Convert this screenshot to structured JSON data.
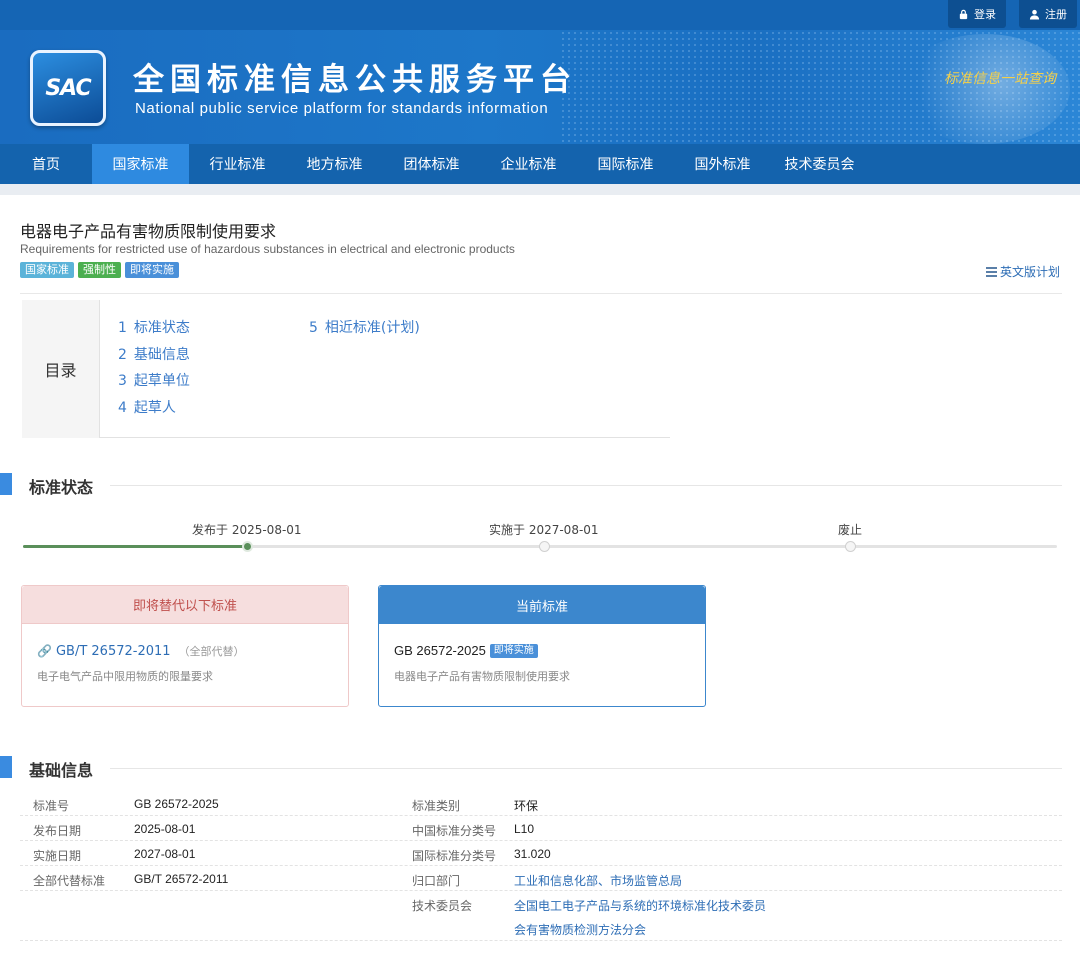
{
  "top_links": {
    "login": "登录",
    "register": "注册"
  },
  "header": {
    "logo_text": "SAC",
    "title": "全国标准信息公共服务平台",
    "subtitle": "National public service platform  for standards information",
    "slogan": "标准信息一站查询"
  },
  "nav": [
    "首页",
    "国家标准",
    "行业标准",
    "地方标准",
    "团体标准",
    "企业标准",
    "国际标准",
    "国外标准",
    "技术委员会"
  ],
  "standard": {
    "title": "电器电子产品有害物质限制使用要求",
    "title_en": "Requirements for restricted use of hazardous substances in electrical and electronic products",
    "tags": [
      "国家标准",
      "强制性",
      "即将实施"
    ],
    "en_plan": "英文版计划"
  },
  "toc": {
    "heading": "目录",
    "items": [
      {
        "num": "1",
        "label": "标准状态"
      },
      {
        "num": "2",
        "label": "基础信息"
      },
      {
        "num": "3",
        "label": "起草单位"
      },
      {
        "num": "4",
        "label": "起草人"
      },
      {
        "num": "5",
        "label": "相近标准(计划)"
      }
    ]
  },
  "status_section": {
    "title": "标准状态",
    "timeline": [
      {
        "label": "发布于 2025-08-01",
        "done": true
      },
      {
        "label": "实施于 2027-08-01",
        "done": false
      },
      {
        "label": "废止",
        "done": false
      }
    ],
    "replaces_box": {
      "header": "即将替代以下标准",
      "code": "GB/T 26572-2011",
      "note": "（全部代替）",
      "name": "电子电气产品中限用物质的限量要求"
    },
    "current_box": {
      "header": "当前标准",
      "code": "GB 26572-2025",
      "badge": "即将实施",
      "name": "电器电子产品有害物质限制使用要求"
    }
  },
  "basic_section": {
    "title": "基础信息",
    "left": [
      {
        "key": "标准号",
        "value": "GB 26572-2025"
      },
      {
        "key": "发布日期",
        "value": "2025-08-01"
      },
      {
        "key": "实施日期",
        "value": "2027-08-01"
      },
      {
        "key": "全部代替标准",
        "value": "GB/T 26572-2011"
      }
    ],
    "right": [
      {
        "key": "标准类别",
        "value": "环保"
      },
      {
        "key": "中国标准分类号",
        "value": "L10"
      },
      {
        "key": "国际标准分类号",
        "value": "31.020"
      },
      {
        "key": "归口部门",
        "value": "工业和信息化部、市场监管总局"
      },
      {
        "key": "技术委员会",
        "value": "全国电工电子产品与系统的环境标准化技术委员会有害物质检测方法分会"
      }
    ],
    "committee_line1": "全国电工电子产品与系统的环境标准化技术委员",
    "committee_line2": "会有害物质检测方法分会"
  },
  "colors": {
    "nav_bg": "#1463ad",
    "nav_active": "#2e8ae0",
    "link": "#2d6db5",
    "tag_national": "#5bb3d9",
    "tag_mandatory": "#4caf50",
    "tag_upcoming": "#4a90d9",
    "timeline_done": "#5a8f5a",
    "replaces_header_bg": "#f6dede",
    "current_header_bg": "#3c87cd"
  }
}
